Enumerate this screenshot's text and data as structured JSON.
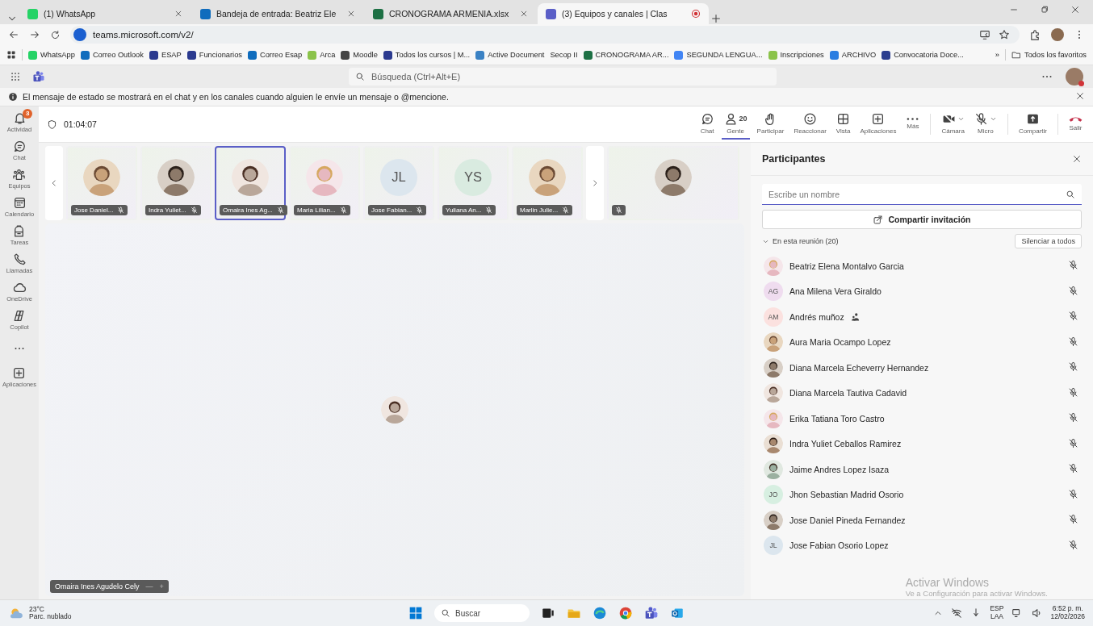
{
  "browser": {
    "tabs": [
      {
        "title": "(1) WhatsApp",
        "selected": false
      },
      {
        "title": "Bandeja de entrada: Beatriz Ele",
        "selected": false
      },
      {
        "title": "CRONOGRAMA ARMENIA.xlsx",
        "selected": false
      },
      {
        "title": "(3) Equipos y canales | Clas",
        "selected": true
      }
    ],
    "url": "teams.microsoft.com/v2/",
    "bookmarks": [
      "WhatsApp",
      "Correo Outlook",
      "ESAP",
      "Funcionarios",
      "Correo Esap",
      "Arca",
      "Moodle",
      "Todos los cursos | M...",
      "Active Document",
      "Secop II",
      "CRONOGRAMA AR...",
      "SEGUNDA LENGUA...",
      "Inscripciones",
      "ARCHIVO",
      "Convocatoria Doce..."
    ],
    "more_bookmarks": "»",
    "all_favorites": "Todos los favoritos"
  },
  "teams_header": {
    "search_placeholder": "Búsqueda (Ctrl+Alt+E)"
  },
  "info_bar": {
    "message": "El mensaje de estado se mostrará en el chat y en los canales cuando alguien le envíe un mensaje o @mencione."
  },
  "rail": {
    "items": [
      {
        "label": "Actividad",
        "badge": "3"
      },
      {
        "label": "Chat"
      },
      {
        "label": "Equipos"
      },
      {
        "label": "Calendario"
      },
      {
        "label": "Tareas"
      },
      {
        "label": "Llamadas"
      },
      {
        "label": "OneDrive"
      },
      {
        "label": "Copilot"
      },
      {
        "label": "Aplicaciones"
      }
    ]
  },
  "meeting": {
    "timer": "01:04:07",
    "toolbar": [
      {
        "label": "Chat",
        "selected": false,
        "has_menu": false
      },
      {
        "label": "Gente",
        "count": "20",
        "selected": true,
        "has_menu": false
      },
      {
        "label": "Participar",
        "selected": false,
        "has_menu": false
      },
      {
        "label": "Reaccionar",
        "selected": false,
        "has_menu": false
      },
      {
        "label": "Vista",
        "selected": false,
        "has_menu": false
      },
      {
        "label": "Aplicaciones",
        "selected": false,
        "has_menu": false
      },
      {
        "label": "Más",
        "selected": false,
        "has_menu": false
      },
      {
        "label": "Cámara",
        "selected": false,
        "has_menu": true
      },
      {
        "label": "Micro",
        "selected": false,
        "has_menu": true
      },
      {
        "label": "Compartir",
        "selected": false,
        "has_menu": false
      },
      {
        "label": "Salir",
        "selected": false,
        "has_menu": false
      }
    ],
    "thumbnails": [
      {
        "name": "Jose Daniel...",
        "kind": "photo",
        "selected": false
      },
      {
        "name": "Indra Yuliet...",
        "kind": "photo",
        "selected": false
      },
      {
        "name": "Omaira Ines Ag...",
        "kind": "photo",
        "selected": true
      },
      {
        "name": "Maria Lilian...",
        "kind": "photo",
        "selected": false
      },
      {
        "name": "Jose Fabian...",
        "kind": "initials",
        "initials": "JL",
        "color": "#dce6ee",
        "selected": false
      },
      {
        "name": "Yuliana An...",
        "kind": "initials",
        "initials": "YS",
        "color": "#d9ebe0",
        "selected": false
      },
      {
        "name": "Marlin Julie...",
        "kind": "photo",
        "selected": false
      },
      {
        "kind": "photo",
        "selected": false
      }
    ],
    "featured": {
      "name": "Omaira Ines Agudelo Cely",
      "minus": "—",
      "plus": "+"
    }
  },
  "participants_panel": {
    "title": "Participantes",
    "search_placeholder": "Escribe un nombre",
    "invite_button": "Compartir invitación",
    "section": "En esta reunión (20)",
    "expanded": true,
    "mute_all_button": "Silenciar a todos",
    "people": [
      {
        "name": "Beatriz Elena Montalvo Garcia",
        "kind": "photo",
        "guest": false
      },
      {
        "name": "Ana Milena Vera Giraldo",
        "kind": "initials",
        "initials": "AG",
        "color": "#efdcef",
        "guest": false
      },
      {
        "name": "Andrés muñoz",
        "kind": "initials",
        "initials": "AM",
        "color": "#fbe1df",
        "guest": true
      },
      {
        "name": "Aura Maria Ocampo Lopez",
        "kind": "photo",
        "guest": false
      },
      {
        "name": "Diana Marcela Echeverry Hernandez",
        "kind": "photo",
        "guest": false
      },
      {
        "name": "Diana Marcela Tautiva Cadavid",
        "kind": "photo",
        "guest": false
      },
      {
        "name": "Erika Tatiana Toro Castro",
        "kind": "photo",
        "guest": false
      },
      {
        "name": "Indra Yuliet Ceballos Ramirez",
        "kind": "photo",
        "guest": false
      },
      {
        "name": "Jaime Andres Lopez Isaza",
        "kind": "photo",
        "guest": false
      },
      {
        "name": "Jhon Sebastian Madrid Osorio",
        "kind": "initials",
        "initials": "JO",
        "color": "#d7efe1",
        "guest": false
      },
      {
        "name": "Jose Daniel Pineda Fernandez",
        "kind": "photo",
        "guest": false
      },
      {
        "name": "Jose Fabian Osorio Lopez",
        "kind": "initials",
        "initials": "JL",
        "color": "#dce6ee",
        "guest": false
      }
    ]
  },
  "windows_notice": {
    "title": "Activar Windows",
    "subtitle": "Ve a Configuración para activar Windows."
  },
  "taskbar": {
    "temperature": "23°C",
    "weather": "Parc. nublado",
    "search_placeholder": "Buscar",
    "language": "ESP",
    "layout": "LAA",
    "time": "6:52 p. m.",
    "date": "12/02/2026"
  }
}
